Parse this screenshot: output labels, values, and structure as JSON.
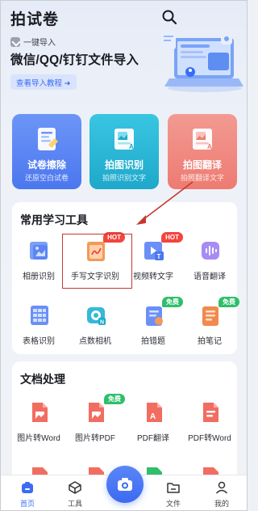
{
  "header": {
    "app_title": "拍试卷",
    "import_hint": "一键导入",
    "import_headline": "微信/QQ/钉钉文件导入",
    "tutorial_label": "查看导入教程 ➜"
  },
  "feature_cards": [
    {
      "title": "试卷擦除",
      "subtitle": "还原空白试卷",
      "color": "#5a84f3"
    },
    {
      "title": "拍图识别",
      "subtitle": "拍照识别文字",
      "color": "#2db5d6"
    },
    {
      "title": "拍图翻译",
      "subtitle": "拍照翻译文字",
      "color": "#f0877e"
    }
  ],
  "tools_section": {
    "title": "常用学习工具",
    "items": [
      {
        "label": "相册识别",
        "icon": "album-scan-icon",
        "badge": ""
      },
      {
        "label": "手写文字识别",
        "icon": "handwriting-icon",
        "badge": "HOT"
      },
      {
        "label": "视频转文字",
        "icon": "video-to-text-icon",
        "badge": "HOT"
      },
      {
        "label": "语音翻译",
        "icon": "voice-translate-icon",
        "badge": ""
      },
      {
        "label": "表格识别",
        "icon": "table-icon",
        "badge": ""
      },
      {
        "label": "点数相机",
        "icon": "count-camera-icon",
        "badge": ""
      },
      {
        "label": "拍错题",
        "icon": "wrong-question-icon",
        "badge": "免费"
      },
      {
        "label": "拍笔记",
        "icon": "notes-icon",
        "badge": "免费"
      }
    ]
  },
  "docs_section": {
    "title": "文档处理",
    "items": [
      {
        "label": "图片转Word",
        "icon": "image-to-word-icon",
        "badge": ""
      },
      {
        "label": "图片转PDF",
        "icon": "image-to-pdf-icon",
        "badge": "免费"
      },
      {
        "label": "PDF翻译",
        "icon": "pdf-translate-icon",
        "badge": ""
      },
      {
        "label": "PDF转Word",
        "icon": "pdf-to-word-icon",
        "badge": ""
      }
    ]
  },
  "bottom_nav": {
    "items": [
      {
        "label": "首页",
        "icon": "home-icon",
        "active": true
      },
      {
        "label": "工具",
        "icon": "toolbox-icon",
        "active": false
      },
      {
        "label": "文件",
        "icon": "folder-icon",
        "active": false
      },
      {
        "label": "我的",
        "icon": "profile-icon",
        "active": false
      }
    ]
  },
  "colors": {
    "accent": "#3b6cf6",
    "hot": "#f2453d",
    "free": "#2fbf6a",
    "annotation": "#c7372f"
  }
}
